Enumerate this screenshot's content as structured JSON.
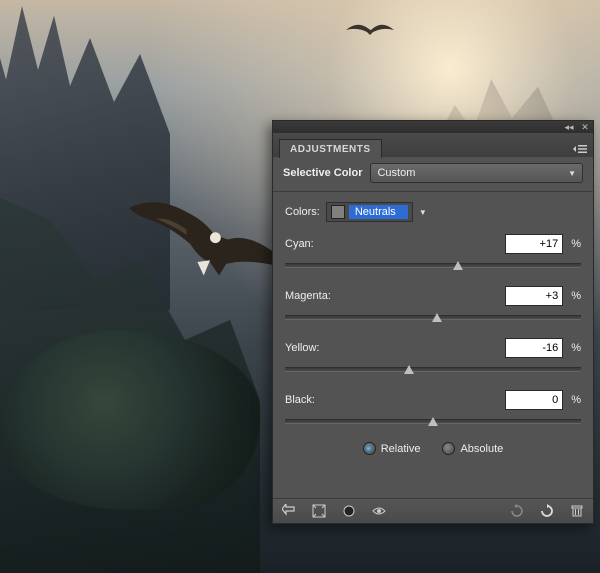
{
  "panel": {
    "tab": "ADJUSTMENTS",
    "adjustment": "Selective Color",
    "preset": "Custom",
    "colors_label": "Colors:",
    "colors_value": "Neutrals",
    "sliders": [
      {
        "name": "Cyan:",
        "value": "+17",
        "pos": 58.5
      },
      {
        "name": "Magenta:",
        "value": "+3",
        "pos": 51.5
      },
      {
        "name": "Yellow:",
        "value": "-16",
        "pos": 42.0
      },
      {
        "name": "Black:",
        "value": "0",
        "pos": 50.0
      }
    ],
    "pct": "%",
    "mode_relative": "Relative",
    "mode_absolute": "Absolute",
    "mode_selected": "relative"
  }
}
